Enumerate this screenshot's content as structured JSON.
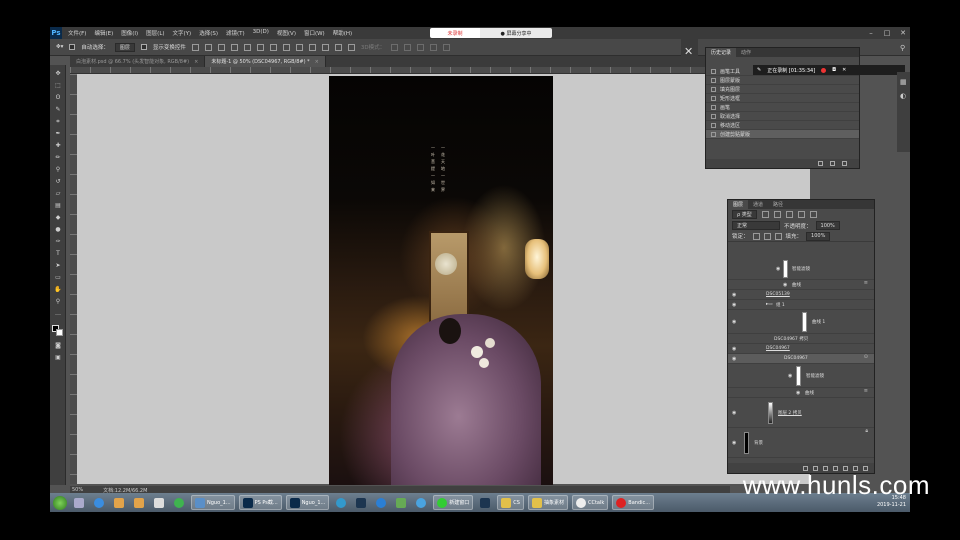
{
  "app": {
    "logo": "Ps",
    "menus": [
      "文件(F)",
      "编辑(E)",
      "图像(I)",
      "图层(L)",
      "文字(Y)",
      "选择(S)",
      "滤镜(T)",
      "3D(D)",
      "视图(V)",
      "窗口(W)",
      "帮助(H)"
    ],
    "recorder_left": "未录制",
    "recorder_right": "● 屏幕分享中"
  },
  "options_bar": {
    "auto_select_label": "自动选择：",
    "auto_select_value": "图层",
    "show_transform_label": "显示变换控件",
    "mode_3d_label": "3D模式："
  },
  "tabs": [
    {
      "label": "白泡素材.psd @ 66.7% (头发智能对象, RGB/8#)",
      "active": false
    },
    {
      "label": "未标题-1 @ 50% (DSC04967, RGB/8#) *",
      "active": true
    }
  ],
  "artwork": {
    "poem_left": "一花天地一世界",
    "poem_right": "一叶菩提一如来"
  },
  "history": {
    "tabs": [
      "历史记录",
      "动作"
    ],
    "items": [
      {
        "label": "画笔工具",
        "selected": false
      },
      {
        "label": "图层蒙版",
        "selected": false
      },
      {
        "label": "填充图层",
        "selected": false
      },
      {
        "label": "矩形选框",
        "selected": false
      },
      {
        "label": "画笔",
        "selected": false
      },
      {
        "label": "取消选择",
        "selected": false
      },
      {
        "label": "移动选区",
        "selected": false
      },
      {
        "label": "创建剪贴蒙版",
        "selected": true
      }
    ],
    "recording": "正在录制 [01:35:34]"
  },
  "layers": {
    "tabs": [
      "图层",
      "通道",
      "路径"
    ],
    "filter_label": "ρ 类型",
    "blend_mode": "正常",
    "opacity_label": "不透明度：",
    "opacity_value": "100%",
    "lock_label": "锁定：",
    "fill_label": "填充：",
    "fill_value": "100%",
    "rows": [
      {
        "name": "智能滤镜",
        "kind": "filter"
      },
      {
        "name": "曲线",
        "kind": "sub"
      },
      {
        "name": "DSC05139",
        "kind": "link"
      },
      {
        "name": "组 1",
        "kind": "group"
      },
      {
        "name": "曲线 1",
        "kind": "adjust"
      },
      {
        "name": "DSC04967 拷贝",
        "kind": "smart"
      },
      {
        "name": "DSC04967",
        "kind": "link"
      },
      {
        "name": "DSC04967",
        "kind": "smart",
        "selected": true
      },
      {
        "name": "智能滤镜",
        "kind": "filter"
      },
      {
        "name": "曲线",
        "kind": "sub"
      },
      {
        "name": "图层 2 拷贝",
        "kind": "layer"
      },
      {
        "name": "背景",
        "kind": "bg"
      }
    ]
  },
  "status": {
    "zoom": "50%",
    "doc": "文档:12.2M/66.2M"
  },
  "taskbar": {
    "items": [
      "Nguo_1...",
      "PS Ps截...",
      "Nguo_1...",
      "新建窗口",
      "CS",
      "抽象素材",
      "CCtalk",
      "Bandic..."
    ],
    "time": "15:48",
    "date": "2019-11-21"
  },
  "watermark": "www.hunls.com",
  "colors": {
    "accent_ps": "#4fb4ff",
    "recording_red": "#e33333",
    "panel_bg": "#4a4a4a"
  }
}
